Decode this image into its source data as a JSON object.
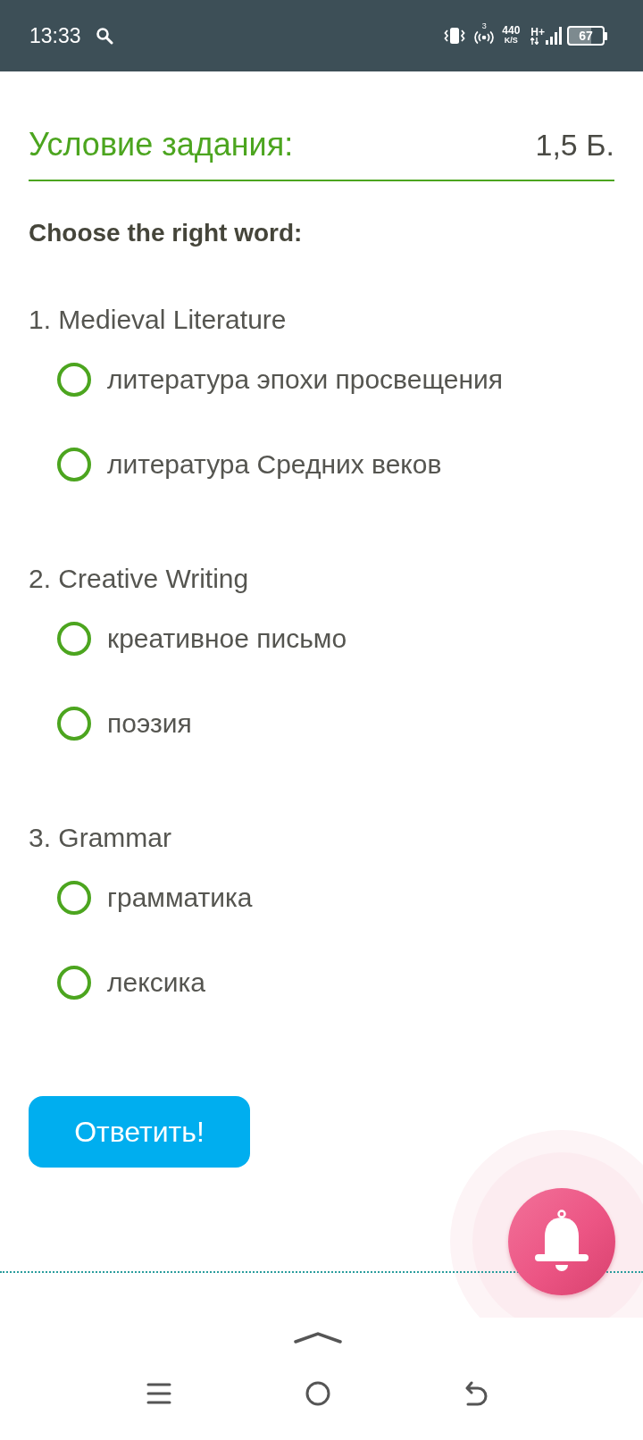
{
  "status_bar": {
    "time": "13:33",
    "hotspot_count": "3",
    "speed_value": "440",
    "speed_unit": "K/S",
    "network_type": "H+",
    "battery": "67"
  },
  "task": {
    "title": "Условие задания:",
    "points": "1,5 Б."
  },
  "instruction": "Choose the right word:",
  "questions": [
    {
      "prompt": "1. Medieval Literature",
      "options": [
        {
          "label": "литература эпохи просвещения",
          "selected": false
        },
        {
          "label": "литература Средних веков",
          "selected": false
        }
      ]
    },
    {
      "prompt": "2. Creative Writing",
      "options": [
        {
          "label": "креативное письмо",
          "selected": false
        },
        {
          "label": "поэзия",
          "selected": false
        }
      ]
    },
    {
      "prompt": "3. Grammar",
      "options": [
        {
          "label": "грамматика",
          "selected": false
        },
        {
          "label": "лексика",
          "selected": false
        }
      ]
    }
  ],
  "submit_button": {
    "label": "Ответить!"
  }
}
